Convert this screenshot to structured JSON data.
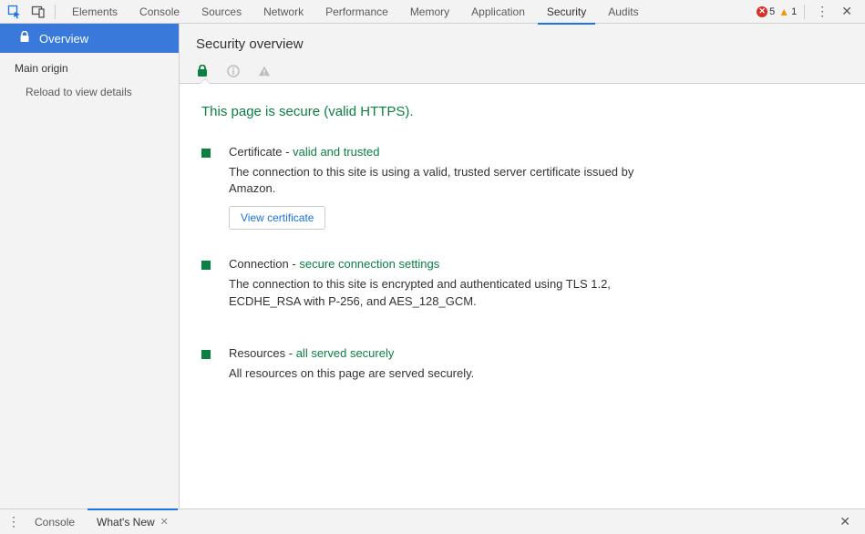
{
  "toolbar": {
    "tabs": {
      "elements": "Elements",
      "console": "Console",
      "sources": "Sources",
      "network": "Network",
      "performance": "Performance",
      "memory": "Memory",
      "application": "Application",
      "security": "Security",
      "audits": "Audits"
    },
    "errors_count": "5",
    "warnings_count": "1"
  },
  "sidebar": {
    "overview_label": "Overview",
    "main_origin_label": "Main origin",
    "reload_hint": "Reload to view details"
  },
  "content": {
    "title": "Security overview",
    "headline": "This page is secure (valid HTTPS).",
    "certificate": {
      "label": "Certificate",
      "dash": " - ",
      "status": "valid and trusted",
      "desc": "The connection to this site is using a valid, trusted server certificate issued by Amazon.",
      "button": "View certificate"
    },
    "connection": {
      "label": "Connection",
      "dash": " - ",
      "status": "secure connection settings",
      "desc": "The connection to this site is encrypted and authenticated using TLS 1.2, ECDHE_RSA with P-256, and AES_128_GCM."
    },
    "resources": {
      "label": "Resources",
      "dash": " - ",
      "status": "all served securely",
      "desc": "All resources on this page are served securely."
    }
  },
  "drawer": {
    "console_tab": "Console",
    "whatsnew_tab": "What's New"
  }
}
